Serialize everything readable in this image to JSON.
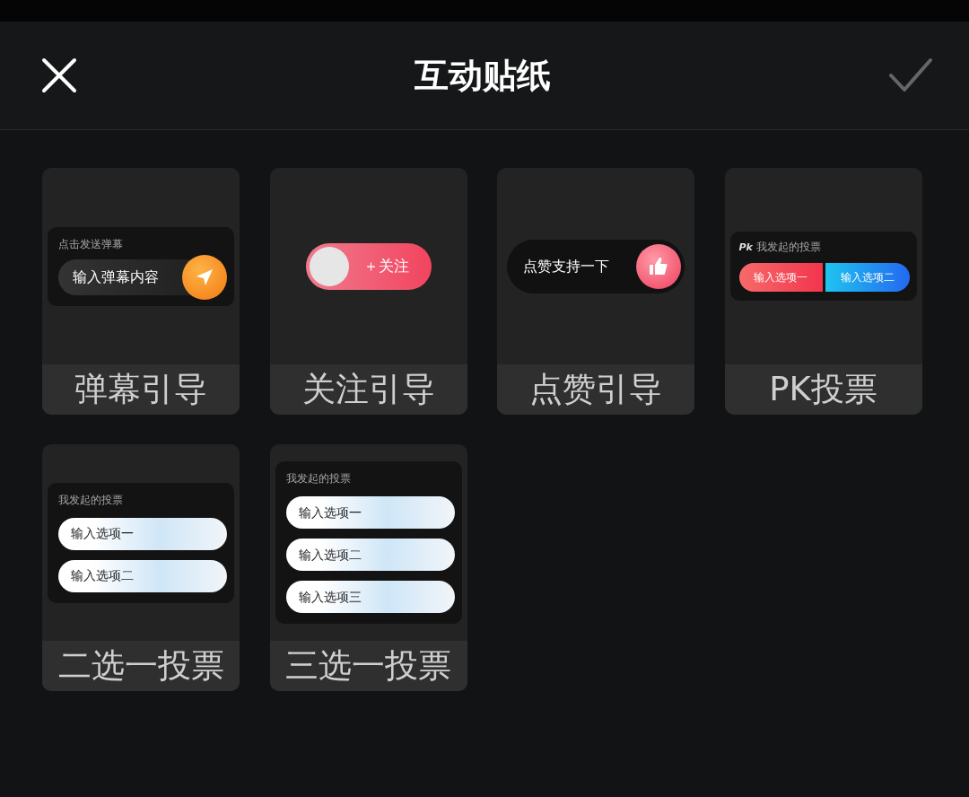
{
  "header": {
    "title": "互动贴纸"
  },
  "stickers": [
    {
      "kind": "danmaku",
      "label": "弹幕引导",
      "caption": "点击发送弹幕",
      "input": "输入弹幕内容"
    },
    {
      "kind": "follow",
      "label": "关注引导",
      "button": "＋关注"
    },
    {
      "kind": "like",
      "label": "点赞引导",
      "text": "点赞支持一下"
    },
    {
      "kind": "pk",
      "label": "PK投票",
      "logo": "Pk",
      "caption": "我发起的投票",
      "options": [
        "输入选项一",
        "输入选项二"
      ]
    },
    {
      "kind": "poll",
      "label": "二选一投票",
      "caption": "我发起的投票",
      "options": [
        "输入选项一",
        "输入选项二"
      ]
    },
    {
      "kind": "poll",
      "label": "三选一投票",
      "caption": "我发起的投票",
      "options": [
        "输入选项一",
        "输入选项二",
        "输入选项三"
      ]
    }
  ]
}
